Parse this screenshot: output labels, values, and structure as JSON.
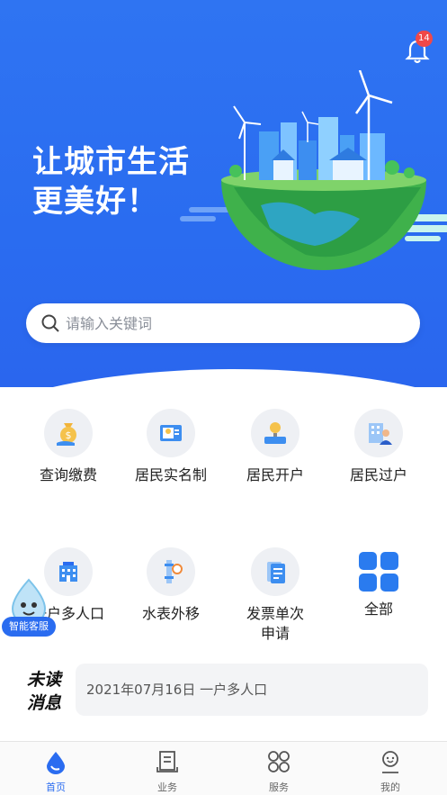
{
  "hero": {
    "slogan_line1": "让城市生活",
    "slogan_line2": "更美好！",
    "notification_count": "14"
  },
  "search": {
    "placeholder": "请输入关键词"
  },
  "services": [
    {
      "label": "查询缴费",
      "icon": "money-bag-icon"
    },
    {
      "label": "居民实名制",
      "icon": "id-card-icon"
    },
    {
      "label": "居民开户",
      "icon": "meter-tap-icon"
    },
    {
      "label": "居民过户",
      "icon": "building-person-icon"
    },
    {
      "label": "一户多人口",
      "icon": "building-icon"
    },
    {
      "label": "水表外移",
      "icon": "pipe-meter-icon"
    },
    {
      "label": "发票单次申请",
      "icon": "invoice-icon"
    },
    {
      "label": "全部",
      "icon": "all-grid-icon"
    }
  ],
  "assistant": {
    "label": "智能客服"
  },
  "unread": {
    "title_line1": "未读",
    "title_line2": "消息",
    "message": "2021年07月16日 一户多人口"
  },
  "tabbar": [
    {
      "label": "首页",
      "icon": "water-drop-icon",
      "active": true
    },
    {
      "label": "业务",
      "icon": "document-icon",
      "active": false
    },
    {
      "label": "服务",
      "icon": "grid-icon",
      "active": false
    },
    {
      "label": "我的",
      "icon": "user-icon",
      "active": false
    }
  ],
  "colors": {
    "primary": "#2a6cf0",
    "badge": "#f04848"
  }
}
